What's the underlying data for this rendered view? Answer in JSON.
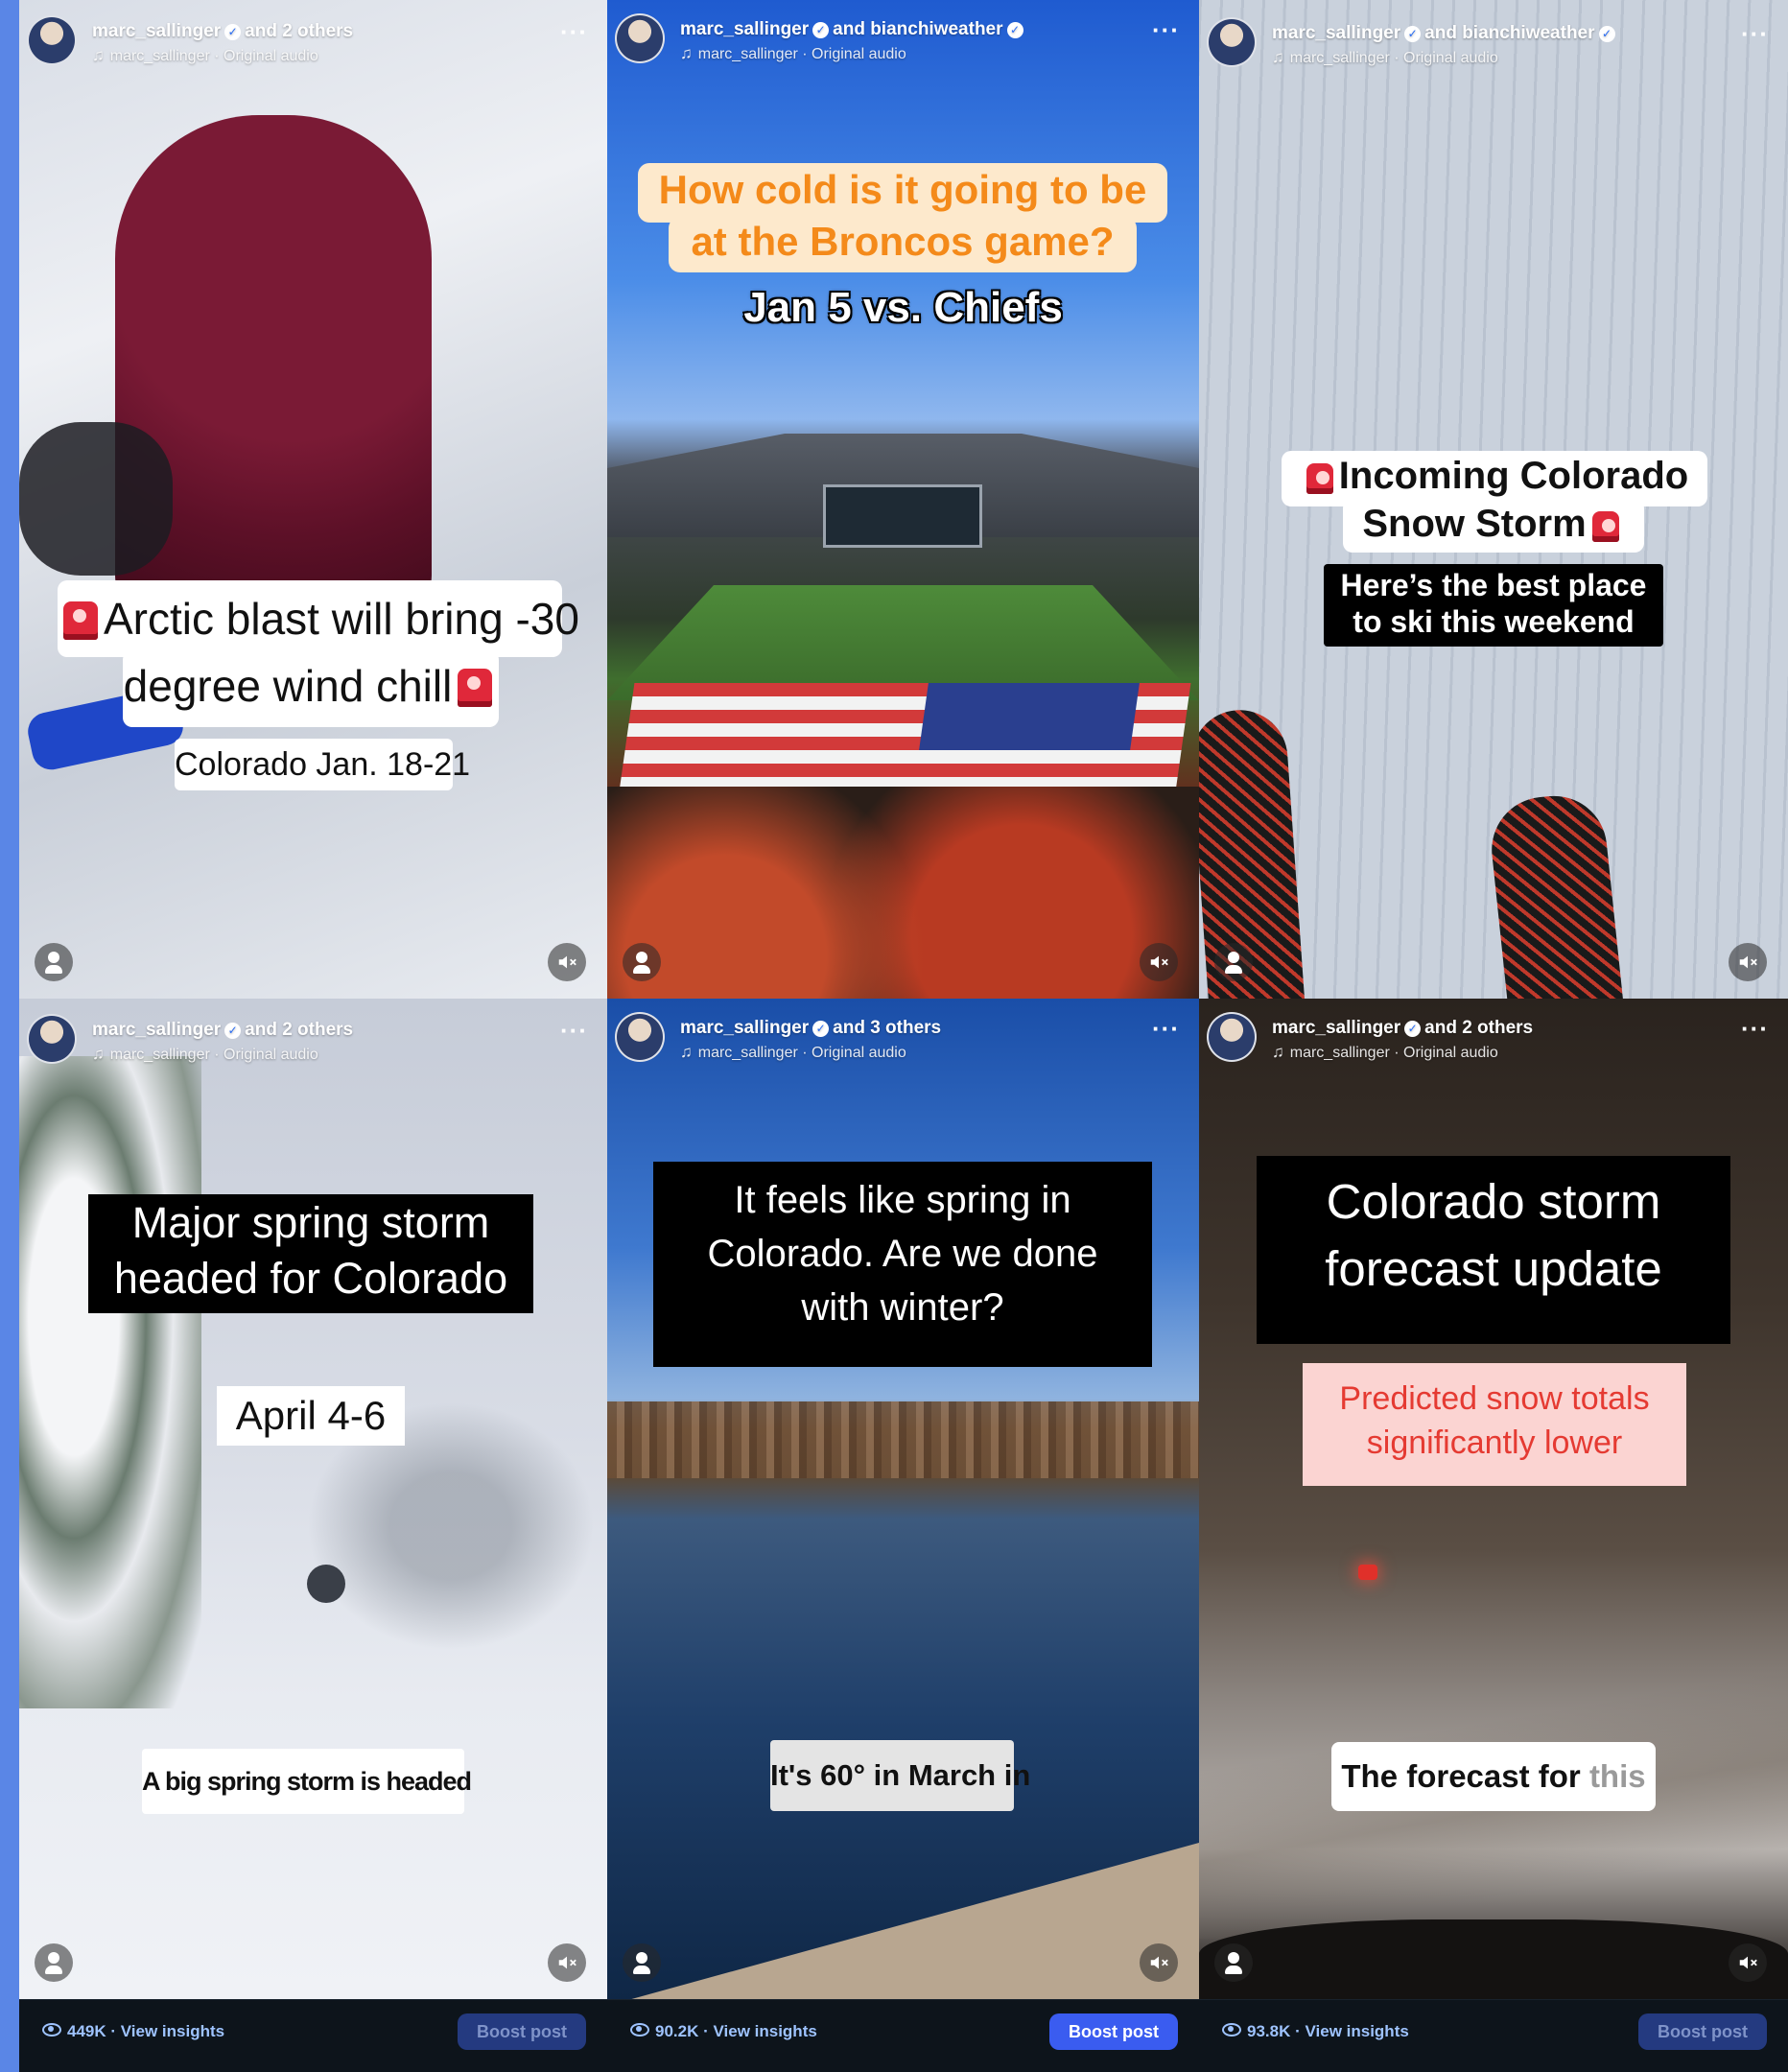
{
  "reels": [
    {
      "header": {
        "username": "marc_sallinger",
        "collaborators": "and 2 others",
        "audio": "marc_sallinger · Original audio"
      },
      "captions": {
        "line1": "Arctic blast will bring -30",
        "line2": "degree wind chill",
        "line3": "Colorado Jan. 18-21"
      }
    },
    {
      "header": {
        "username": "marc_sallinger",
        "collaborators": "and bianchiweather",
        "audio": "marc_sallinger · Original audio"
      },
      "captions": {
        "line1": "How cold is it going to be",
        "line2": "at the Broncos game?",
        "line3": "Jan 5 vs. Chiefs"
      }
    },
    {
      "header": {
        "username": "marc_sallinger",
        "collaborators": "and bianchiweather",
        "audio": "marc_sallinger · Original audio"
      },
      "captions": {
        "line1": "Incoming Colorado",
        "line2": "Snow Storm",
        "line3": "Here’s the best place",
        "line4": "to ski this weekend"
      }
    },
    {
      "header": {
        "username": "marc_sallinger",
        "collaborators": "and 2 others",
        "audio": "marc_sallinger · Original audio"
      },
      "captions": {
        "line1": "Major spring storm",
        "line2": "headed for Colorado",
        "line3": "April 4-6",
        "line4": "A big spring storm is headed"
      }
    },
    {
      "header": {
        "username": "marc_sallinger",
        "collaborators": "and 3 others",
        "audio": "marc_sallinger · Original audio"
      },
      "captions": {
        "line1": "It feels like spring in",
        "line2": "Colorado. Are we done",
        "line3": "with winter?",
        "line4": "It's 60° in March in"
      }
    },
    {
      "header": {
        "username": "marc_sallinger",
        "collaborators": "and 2 others",
        "audio": "marc_sallinger · Original audio"
      },
      "captions": {
        "line1": "Colorado storm",
        "line2": "forecast update",
        "line3": "Predicted snow totals",
        "line4": "significantly lower",
        "line5": "The forecast for",
        "line5b": "this"
      }
    }
  ],
  "footer": [
    {
      "views": "449K",
      "link": "View insights",
      "boost": "Boost post"
    },
    {
      "views": "90.2K",
      "link": "View insights",
      "boost": "Boost post"
    },
    {
      "views": "93.8K",
      "link": "View insights",
      "boost": "Boost post"
    }
  ],
  "icons": {
    "more": "more-options-icon",
    "profile": "profile-icon",
    "mute": "muted-speaker-icon",
    "verified": "verified-badge-icon",
    "audio": "music-note-icon",
    "views": "eye-icon",
    "siren": "siren-emoji-icon"
  },
  "colors": {
    "boost_active": "#3a5cf0",
    "boost_dim": "#243a80",
    "insights_link": "#9ec3ff",
    "accent_orange": "#f48a1a"
  }
}
